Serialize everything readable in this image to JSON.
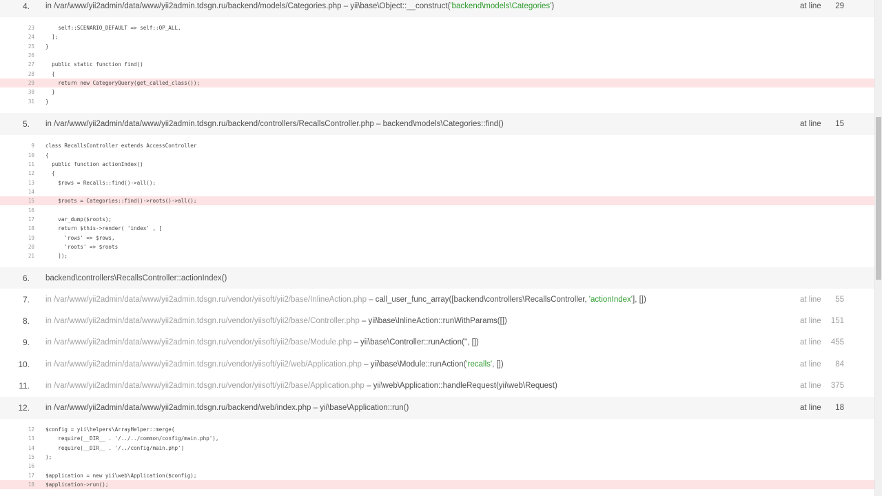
{
  "frames": [
    {
      "num": "4.",
      "file": "in /var/www/yii2admin/data/www/yii2admin.tdsgn.ru/backend/models/Categories.php",
      "sep": " – ",
      "call": "yii\\base\\Object::__construct(",
      "str": "'backend\\models\\Categories'",
      "tail": ")",
      "at": "at line",
      "line": "29"
    },
    {
      "num": "5.",
      "file": "in /var/www/yii2admin/data/www/yii2admin.tdsgn.ru/backend/controllers/RecallsController.php",
      "sep": " – ",
      "call": "backend\\models\\Categories::find()",
      "at": "at line",
      "line": "15"
    },
    {
      "num": "6.",
      "file": "backend\\controllers\\RecallsController::actionIndex()"
    },
    {
      "num": "7.",
      "file": "in /var/www/yii2admin/data/www/yii2admin.tdsgn.ru/vendor/yiisoft/yii2/base/InlineAction.php",
      "sep": " – ",
      "call": "call_user_func_array([backend\\controllers\\RecallsController, ",
      "str": "'actionIndex'",
      "tail": "], [])",
      "at": "at line",
      "line": "55"
    },
    {
      "num": "8.",
      "file": "in /var/www/yii2admin/data/www/yii2admin.tdsgn.ru/vendor/yiisoft/yii2/base/Controller.php",
      "sep": " – ",
      "call": "yii\\base\\InlineAction::runWithParams([])",
      "at": "at line",
      "line": "151"
    },
    {
      "num": "9.",
      "file": "in /var/www/yii2admin/data/www/yii2admin.tdsgn.ru/vendor/yiisoft/yii2/base/Module.php",
      "sep": " – ",
      "call": "yii\\base\\Controller::runAction('', [])",
      "at": "at line",
      "line": "455"
    },
    {
      "num": "10.",
      "file": "in /var/www/yii2admin/data/www/yii2admin.tdsgn.ru/vendor/yiisoft/yii2/web/Application.php",
      "sep": " – ",
      "call": "yii\\base\\Module::runAction(",
      "str": "'recalls'",
      "tail": ", [])",
      "at": "at line",
      "line": "84"
    },
    {
      "num": "11.",
      "file": "in /var/www/yii2admin/data/www/yii2admin.tdsgn.ru/vendor/yiisoft/yii2/base/Application.php",
      "sep": " – ",
      "call": "yii\\web\\Application::handleRequest(yii\\web\\Request)",
      "at": "at line",
      "line": "375"
    },
    {
      "num": "12.",
      "file": "in /var/www/yii2admin/data/www/yii2admin.tdsgn.ru/backend/web/index.php",
      "sep": " – ",
      "call": "yii\\base\\Application::run()",
      "at": "at line",
      "line": "18"
    }
  ],
  "snippets": [
    {
      "lines": [
        {
          "n": "23",
          "code": "    self::SCENARIO_DEFAULT => self::OP_ALL,"
        },
        {
          "n": "24",
          "code": "  ];"
        },
        {
          "n": "25",
          "code": "}"
        },
        {
          "n": "26",
          "code": ""
        },
        {
          "n": "27",
          "code": "  public static function find()"
        },
        {
          "n": "28",
          "code": "  {"
        },
        {
          "n": "29",
          "code": "    return new CategoryQuery(get_called_class());"
        },
        {
          "n": "30",
          "code": "  }"
        },
        {
          "n": "31",
          "code": "}"
        }
      ]
    },
    {
      "lines": [
        {
          "n": "9",
          "code": "class RecallsController extends AccessController"
        },
        {
          "n": "10",
          "code": "{"
        },
        {
          "n": "11",
          "code": "  public function actionIndex()"
        },
        {
          "n": "12",
          "code": "  {"
        },
        {
          "n": "13",
          "code": "    $rows = Recalls::find()->all();"
        },
        {
          "n": "14",
          "code": ""
        },
        {
          "n": "15",
          "code": "    $roots = Categories::find()->roots()->all();"
        },
        {
          "n": "16",
          "code": ""
        },
        {
          "n": "17",
          "code": "    var_dump($roots);"
        },
        {
          "n": "18",
          "code": "    return $this->render( 'index' , ["
        },
        {
          "n": "19",
          "code": "      'rows' => $rows,"
        },
        {
          "n": "20",
          "code": "      'roots' => $roots"
        },
        {
          "n": "21",
          "code": "    ]);"
        }
      ]
    },
    {
      "lines": [
        {
          "n": "12",
          "code": "$config = yii\\helpers\\ArrayHelper::merge("
        },
        {
          "n": "13",
          "code": "    require(__DIR__ . '/../../common/config/main.php'),"
        },
        {
          "n": "14",
          "code": "    require(__DIR__ . '/../config/main.php')"
        },
        {
          "n": "15",
          "code": ");"
        },
        {
          "n": "16",
          "code": ""
        },
        {
          "n": "17",
          "code": "$application = new yii\\web\\Application($config);"
        },
        {
          "n": "18",
          "code": "$application->run();"
        }
      ]
    }
  ],
  "colors": {
    "app_row_bg": "#f6f6f6",
    "error_line_bg": "#fde3e3",
    "string": "#2e9b2e",
    "muted": "#a0a0a0"
  }
}
